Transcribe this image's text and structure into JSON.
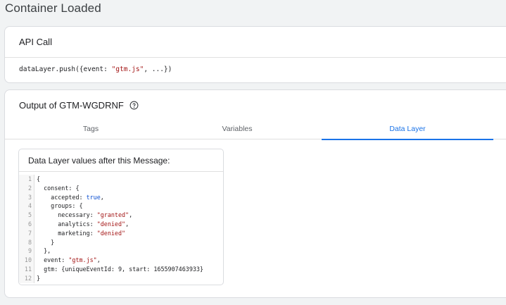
{
  "page": {
    "title": "Container Loaded"
  },
  "api_call": {
    "header": "API Call",
    "code_prefix": "dataLayer.push({event: ",
    "code_event": "\"gtm.js\"",
    "code_suffix": ", ...})"
  },
  "output": {
    "title": "Output of GTM-WGDRNF",
    "tabs": [
      {
        "label": "Tags"
      },
      {
        "label": "Variables"
      },
      {
        "label": "Data Layer"
      }
    ],
    "active_tab": "Data Layer",
    "data_layer": {
      "header": "Data Layer values after this Message:",
      "line_numbers": [
        "1",
        "2",
        "3",
        "4",
        "5",
        "6",
        "7",
        "8",
        "9",
        "10",
        "11",
        "12"
      ],
      "code_lines": [
        [
          "{"
        ],
        [
          "  consent: {"
        ],
        [
          "    accepted: ",
          "true",
          ","
        ],
        [
          "    groups: {"
        ],
        [
          "      necessary: ",
          "\"granted\"",
          ","
        ],
        [
          "      analytics: ",
          "\"denied\"",
          ","
        ],
        [
          "      marketing: ",
          "\"denied\""
        ],
        [
          "    }"
        ],
        [
          "  },"
        ],
        [
          "  event: ",
          "\"gtm.js\"",
          ","
        ],
        [
          "  gtm: {uniqueEventId: 9, start: 1655907463933}"
        ],
        [
          "}"
        ]
      ]
    }
  },
  "colors": {
    "accent": "#1a73e8",
    "string": "#a31515",
    "keyword": "#0b4fd1"
  }
}
